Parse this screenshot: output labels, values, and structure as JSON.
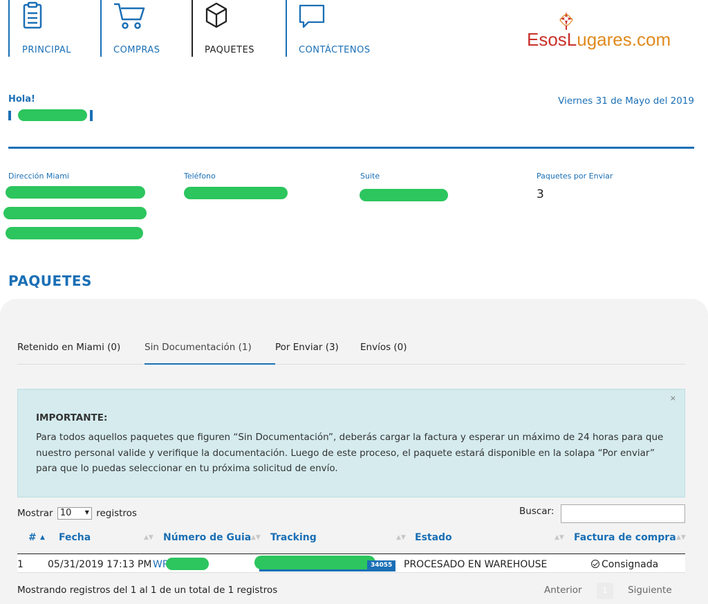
{
  "nav": {
    "items": [
      {
        "label": "PRINCIPAL",
        "icon": "clipboard-icon"
      },
      {
        "label": "COMPRAS",
        "icon": "cart-icon"
      },
      {
        "label": "PAQUETES",
        "icon": "box-icon",
        "active": true
      },
      {
        "label": "CONTÁCTENOS",
        "icon": "speech-bubble-icon"
      }
    ]
  },
  "logo": {
    "part1": "EsosL",
    "part2": "ugares.com"
  },
  "greeting": {
    "hello": "Hola!",
    "date": "Viernes 31 de Mayo del 2019"
  },
  "info": {
    "address_label": "Dirección Miami",
    "phone_label": "Teléfono",
    "suite_label": "Suite",
    "pending_label": "Paquetes por Enviar",
    "pending_value": "3"
  },
  "section_title": "PAQUETES",
  "tabs": [
    {
      "label": "Retenido en Miami (0)"
    },
    {
      "label": "Sin Documentación (1)",
      "active": true
    },
    {
      "label": "Por Enviar (3)"
    },
    {
      "label": "Envíos (0)"
    }
  ],
  "alert": {
    "close": "×",
    "title": "IMPORTANTE:",
    "body": "Para todos aquellos paquetes que figuren “Sin Documentación”, deberás cargar la factura y esperar un máximo de 24 horas para que nuestro personal valide y verifique la documentación. Luego de este proceso, el paquete estará disponible en la solapa “Por enviar” para que lo puedas seleccionar en tu próxima solicitud de envío."
  },
  "table_controls": {
    "show_prefix": "Mostrar",
    "page_size": "10",
    "show_suffix": "registros",
    "search_label": "Buscar:",
    "search_value": ""
  },
  "table": {
    "columns": [
      "#",
      "Fecha",
      "Número de Guia",
      "Tracking",
      "Estado",
      "Factura de compra"
    ],
    "rows": [
      {
        "num": "1",
        "fecha": "05/31/2019 17:13 PM",
        "guia_prefix": "WR",
        "tracking_suffix": "34055",
        "estado": "PROCESADO EN WAREHOUSE",
        "factura": "Consignada"
      }
    ]
  },
  "footer": {
    "info": "Mostrando registros del 1 al 1 de un total de 1 registros",
    "prev": "Anterior",
    "page": "1",
    "next": "Siguiente"
  },
  "colors": {
    "accent": "#1a6fb5",
    "redaction": "#2cc55e",
    "alert_bg": "#d5ebee",
    "logo_red": "#c9312b",
    "logo_orange": "#e08a1e"
  }
}
